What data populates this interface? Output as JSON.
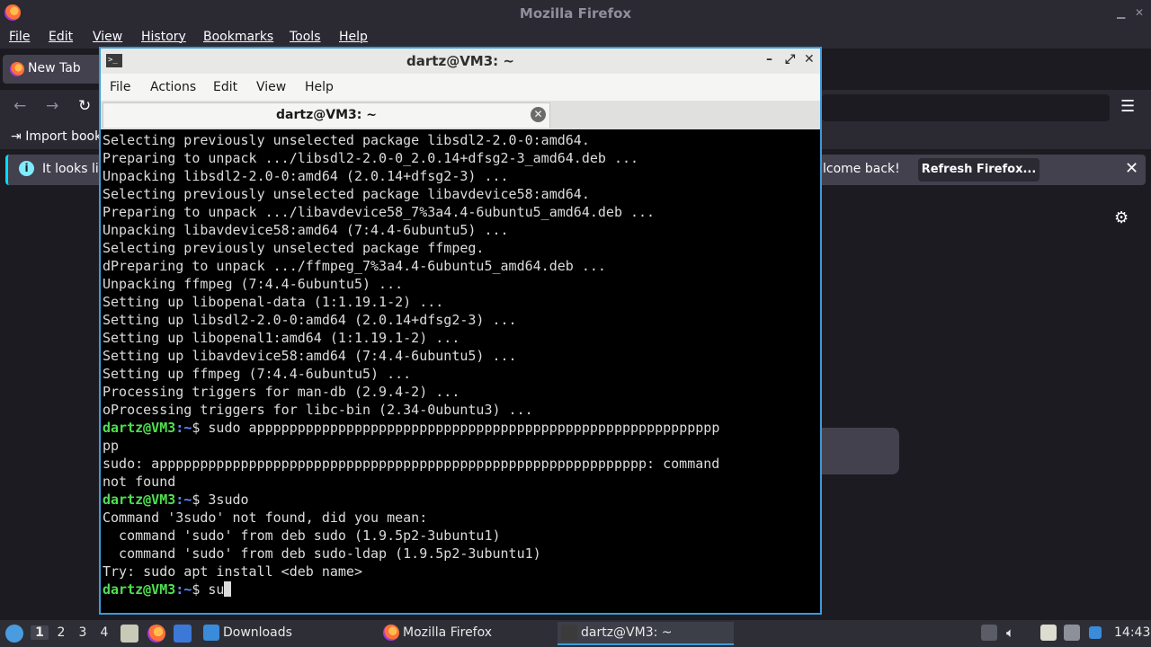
{
  "firefox": {
    "window_title": "Mozilla Firefox",
    "menu": [
      "File",
      "Edit",
      "View",
      "History",
      "Bookmarks",
      "Tools",
      "Help"
    ],
    "tab_label": "New Tab",
    "import_bookmarks": "Import book",
    "notification_left": "It looks lik",
    "notification_right": "lcome back!",
    "refresh_button": "Refresh Firefox...",
    "close_glyph": "✕",
    "settings_glyph": "⚙",
    "menu_glyph": "☰",
    "back_glyph": "←",
    "forward_glyph": "→",
    "reload_glyph": "↻"
  },
  "terminal": {
    "window_title": "dartz@VM3: ~",
    "menu": [
      "File",
      "Actions",
      "Edit",
      "View",
      "Help"
    ],
    "tab_title": "dartz@VM3: ~",
    "prompt_user": "dartz@VM3",
    "prompt_path": ":~",
    "prompt_symbol": "$ ",
    "lines": [
      {
        "type": "text",
        "text": "Selecting previously unselected package libsdl2-2.0-0:amd64."
      },
      {
        "type": "text",
        "text": "Preparing to unpack .../libsdl2-2.0-0_2.0.14+dfsg2-3_amd64.deb ..."
      },
      {
        "type": "text",
        "text": "Unpacking libsdl2-2.0-0:amd64 (2.0.14+dfsg2-3) ..."
      },
      {
        "type": "text",
        "text": "Selecting previously unselected package libavdevice58:amd64."
      },
      {
        "type": "text",
        "text": "Preparing to unpack .../libavdevice58_7%3a4.4-6ubuntu5_amd64.deb ..."
      },
      {
        "type": "text",
        "text": "Unpacking libavdevice58:amd64 (7:4.4-6ubuntu5) ..."
      },
      {
        "type": "text",
        "text": "Selecting previously unselected package ffmpeg."
      },
      {
        "type": "text",
        "text": "dPreparing to unpack .../ffmpeg_7%3a4.4-6ubuntu5_amd64.deb ..."
      },
      {
        "type": "text",
        "text": "Unpacking ffmpeg (7:4.4-6ubuntu5) ..."
      },
      {
        "type": "text",
        "text": "Setting up libopenal-data (1:1.19.1-2) ..."
      },
      {
        "type": "text",
        "text": "Setting up libsdl2-2.0-0:amd64 (2.0.14+dfsg2-3) ..."
      },
      {
        "type": "text",
        "text": "Setting up libopenal1:amd64 (1:1.19.1-2) ..."
      },
      {
        "type": "text",
        "text": "Setting up libavdevice58:amd64 (7:4.4-6ubuntu5) ..."
      },
      {
        "type": "text",
        "text": "Setting up ffmpeg (7:4.4-6ubuntu5) ..."
      },
      {
        "type": "text",
        "text": "Processing triggers for man-db (2.9.4-2) ..."
      },
      {
        "type": "text",
        "text": "oProcessing triggers for libc-bin (2.34-0ubuntu3) ..."
      },
      {
        "type": "prompt",
        "text": "sudo appppppppppppppppppppppppppppppppppppppppppppppppppppppppp"
      },
      {
        "type": "text",
        "text": "pp"
      },
      {
        "type": "text",
        "text": "sudo: apppppppppppppppppppppppppppppppppppppppppppppppppppppppppppp: command"
      },
      {
        "type": "text",
        "text": "not found"
      },
      {
        "type": "prompt",
        "text": "3sudo"
      },
      {
        "type": "text",
        "text": "Command '3sudo' not found, did you mean:"
      },
      {
        "type": "text",
        "text": "  command 'sudo' from deb sudo (1.9.5p2-3ubuntu1)"
      },
      {
        "type": "text",
        "text": "  command 'sudo' from deb sudo-ldap (1.9.5p2-3ubuntu1)"
      },
      {
        "type": "text",
        "text": "Try: sudo apt install <deb name>"
      },
      {
        "type": "prompt",
        "text": "su",
        "cursor": true
      }
    ]
  },
  "taskbar": {
    "workspaces": [
      "1",
      "2",
      "3",
      "4"
    ],
    "tasks": [
      {
        "label": "Downloads",
        "icon": "folder-icon"
      },
      {
        "label": "Mozilla Firefox",
        "icon": "firefox-icon"
      },
      {
        "label": "dartz@VM3: ~",
        "icon": "terminal-icon"
      }
    ],
    "clock": "14:43"
  }
}
